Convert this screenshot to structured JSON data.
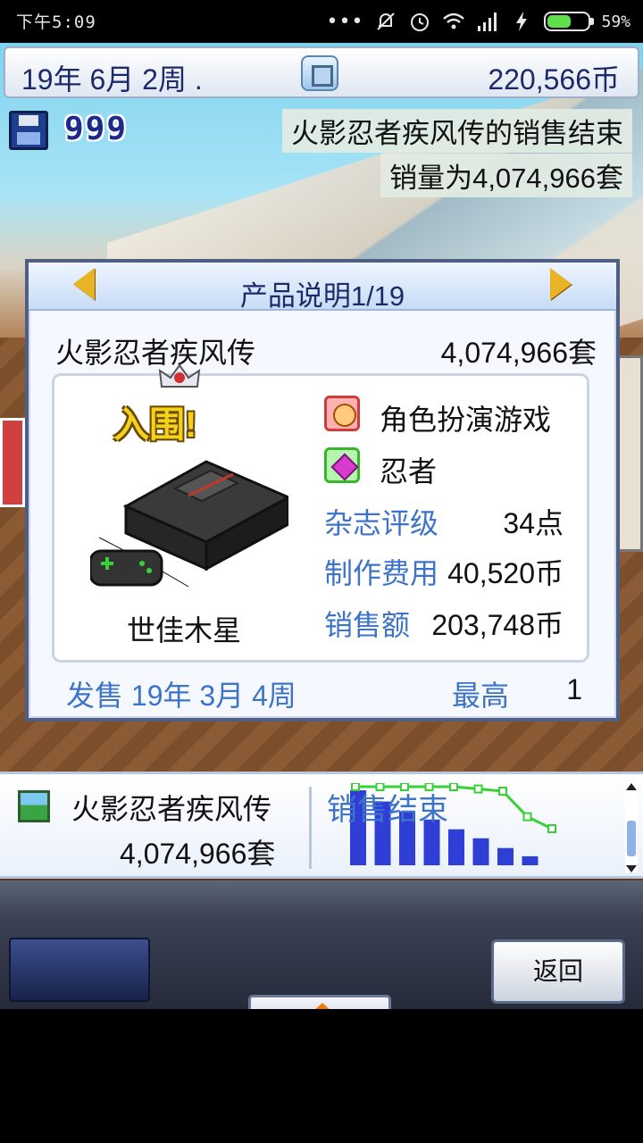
{
  "status_bar": {
    "time": "下午5:09",
    "battery_percent": "59%",
    "battery_level": 0.59,
    "icons": [
      "more-dots-icon",
      "notifications-off-icon",
      "alarm-icon",
      "wifi-icon",
      "signal-icon",
      "charging-icon",
      "battery-icon"
    ]
  },
  "top_bar": {
    "date": "19年 6月 2周",
    "date_dot": ".",
    "money": "220,566币"
  },
  "save": {
    "count": "999"
  },
  "notifications": [
    "火影忍者疾风传的销售结束",
    "销量为4,074,966套"
  ],
  "dialog": {
    "title": "产品说明1/19",
    "product_name": "火影忍者疾风传",
    "total_sales": "4,074,966套",
    "hall_of_fame": "入围!",
    "platform": "世佳木星",
    "genres": [
      "角色扮演游戏",
      "忍者"
    ],
    "stats": [
      {
        "label": "杂志评级",
        "value": "34点"
      },
      {
        "label": "制作费用",
        "value": "40,520币"
      },
      {
        "label": "销售额",
        "value": "203,748币"
      }
    ],
    "release": "发售 19年 3月 4周",
    "peak_label": "最高",
    "peak_value": "1"
  },
  "product_strip": {
    "name": "火影忍者疾风传",
    "sales": "4,074,966套",
    "status": "销售结束",
    "chart_data": {
      "type": "bar",
      "bars": [
        10,
        8.5,
        7.2,
        6.1,
        4.8,
        3.6,
        2.3,
        1.2
      ],
      "line": [
        10,
        10,
        10,
        10,
        10,
        9.7,
        9.4,
        6.0,
        4.4
      ]
    }
  },
  "nav": {
    "back_label": "返回"
  },
  "colors": {
    "accent_blue": "#3d73c9",
    "title_navy": "#1d2a6a",
    "hof_gold": "#f4d21c",
    "chart_bar": "#2f3fd6",
    "chart_line": "#35d135"
  }
}
